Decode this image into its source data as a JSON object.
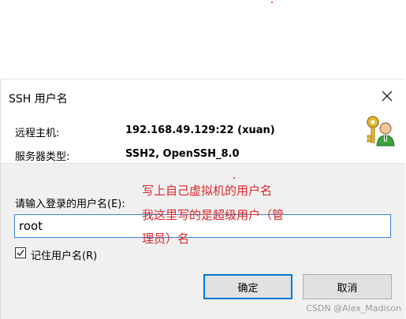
{
  "dialog": {
    "title": "SSH 用户名",
    "host_label": "远程主机:",
    "host_value": "192.168.49.129:22 (xuan)",
    "server_type_label": "服务器类型:",
    "server_type_value": "SSH2, OpenSSH_8.0",
    "prompt_label": "请输入登录的用户名(E):",
    "username_value": "root",
    "remember_label": "记住用户名(R)",
    "remember_checked": true,
    "ok_label": "确定",
    "cancel_label": "取消"
  },
  "annotation": {
    "line1": "写上自己虚拟机的用户名",
    "line2": "我这里写的是超级用户（管",
    "line3": "理员）名"
  },
  "watermark": "CSDN @Alex_Madison",
  "icons": {
    "close": "close-icon",
    "key": "key-user-icon",
    "check": "check-icon"
  },
  "colors": {
    "accent": "#0078d7",
    "annotation": "#d9262b",
    "input_border": "#3c7fd6"
  }
}
